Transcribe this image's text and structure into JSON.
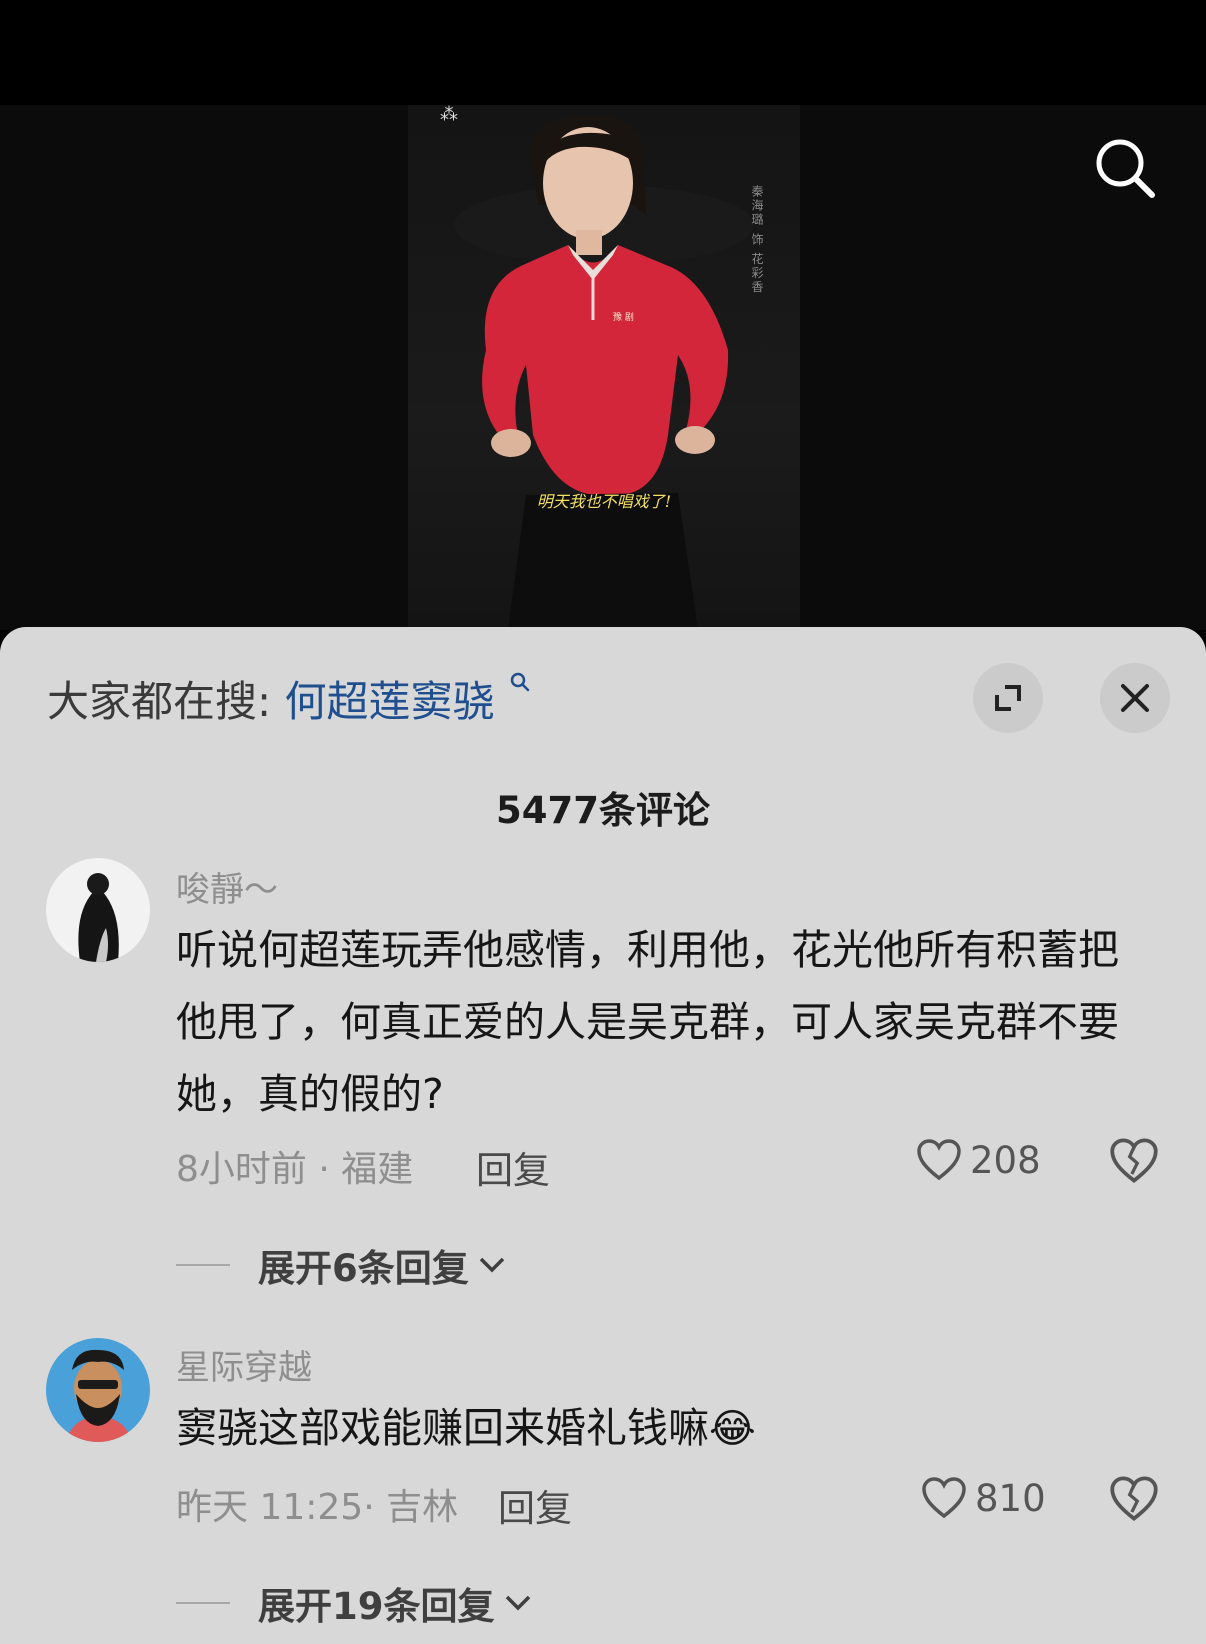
{
  "video": {
    "side_caption": "秦海璐 饰 花彩香",
    "subtitle": "明天我也不唱戏了!"
  },
  "comment_sheet": {
    "hot_search_label": "大家都在搜:",
    "hot_search_term": "何超莲窦骁",
    "count_label": "5477条评论"
  },
  "comments": [
    {
      "username": "唆靜～",
      "text": "听说何超莲玩弄他感情，利用他，花光他所有积蓄把他甩了，何真正爱的人是吴克群，可人家吴克群不要她，真的假的?",
      "meta": "8小时前 · 福建",
      "reply_label": "回复",
      "likes": "208",
      "expand_label": "展开6条回复"
    },
    {
      "username": "星际穿越",
      "text": "窦骁这部戏能赚回来婚礼钱嘛",
      "emoji": "😂",
      "meta": "昨天 11:25· 吉林",
      "reply_label": "回复",
      "likes": "810",
      "expand_label": "展开19条回复"
    }
  ],
  "icons": [
    "search-icon",
    "search-small-icon",
    "expand-icon",
    "close-icon",
    "heart-icon",
    "broken-heart-icon",
    "chevron-down-icon"
  ],
  "colors": {
    "sheet_bg": "#d8d8d8",
    "hot_term": "#1f4f8f",
    "sweater_red": "#d4263a"
  }
}
